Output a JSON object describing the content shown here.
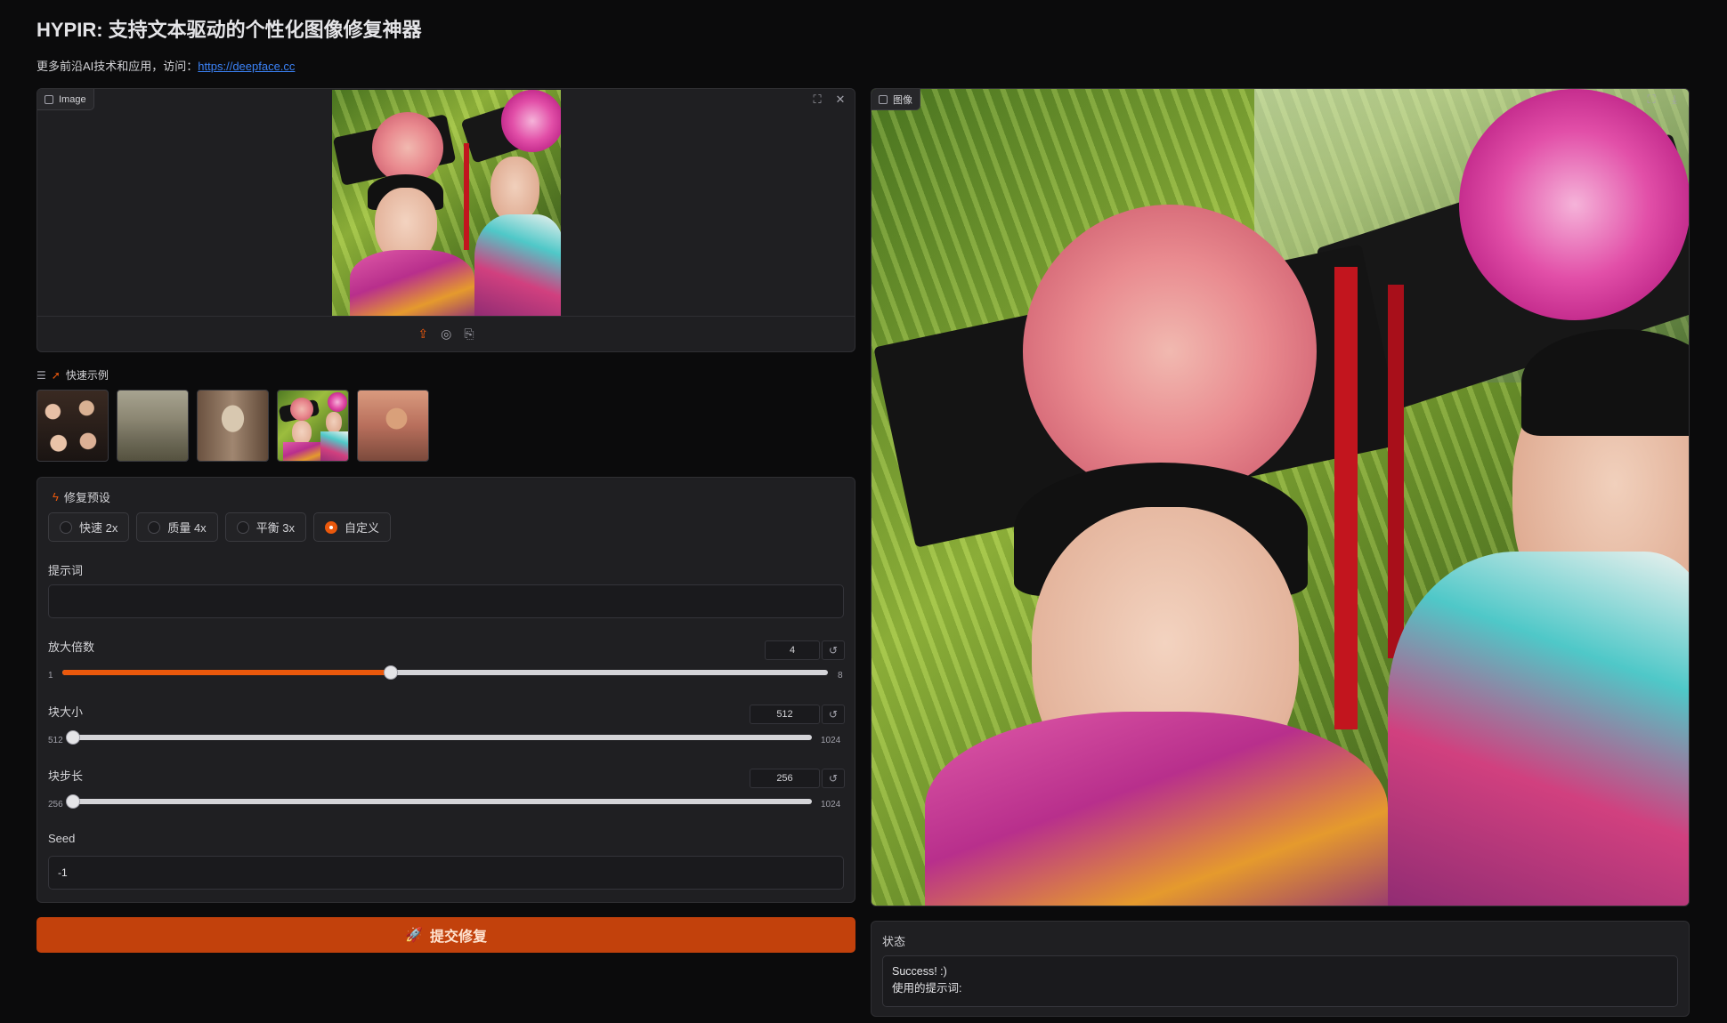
{
  "header": {
    "title": "HYPIR: 支持文本驱动的个性化图像修复神器",
    "subtitle_prefix": "更多前沿AI技术和应用，访问：",
    "subtitle_link": "https://deepface.cc"
  },
  "input_image": {
    "label": "Image",
    "toolbar_icons": [
      "fullscreen-icon",
      "close-icon"
    ],
    "footer_icons": [
      "upload-icon",
      "webcam-icon",
      "clipboard-icon"
    ]
  },
  "examples": {
    "label": "快速示例",
    "items": [
      "friends-group-photo",
      "ruins-landscape",
      "dog-portrait",
      "qing-dynasty-portrait",
      "anime-character"
    ]
  },
  "settings": {
    "title": "修复预设",
    "presets": [
      {
        "label": "快速 2x",
        "checked": false
      },
      {
        "label": "质量 4x",
        "checked": false
      },
      {
        "label": "平衡 3x",
        "checked": false
      },
      {
        "label": "自定义",
        "checked": true
      }
    ],
    "prompt_label": "提示词",
    "prompt_value": "",
    "upscale": {
      "label": "放大倍数",
      "value": "4",
      "min": "1",
      "max": "8",
      "value_num": 4,
      "min_num": 1,
      "max_num": 8
    },
    "patch_size": {
      "label": "块大小",
      "value": "512",
      "min": "512",
      "max": "1024",
      "value_num": 512,
      "min_num": 512,
      "max_num": 1024
    },
    "stride": {
      "label": "块步长",
      "value": "256",
      "min": "256",
      "max": "1024",
      "value_num": 256,
      "min_num": 256,
      "max_num": 1024
    },
    "seed_label": "Seed",
    "seed_value": "-1",
    "reset_glyph": "↺"
  },
  "submit": {
    "label": "提交修复"
  },
  "output_image": {
    "label": "图像",
    "toolbar_icons": [
      "fullscreen-icon",
      "download-icon"
    ]
  },
  "status": {
    "label": "状态",
    "line1": "Success! :)",
    "line2": "使用的提示词:"
  },
  "colors": {
    "accent": "#ea580c",
    "submit_bg": "#c2410c",
    "panel_bg": "#1f1f22",
    "page_bg": "#0b0b0c"
  }
}
